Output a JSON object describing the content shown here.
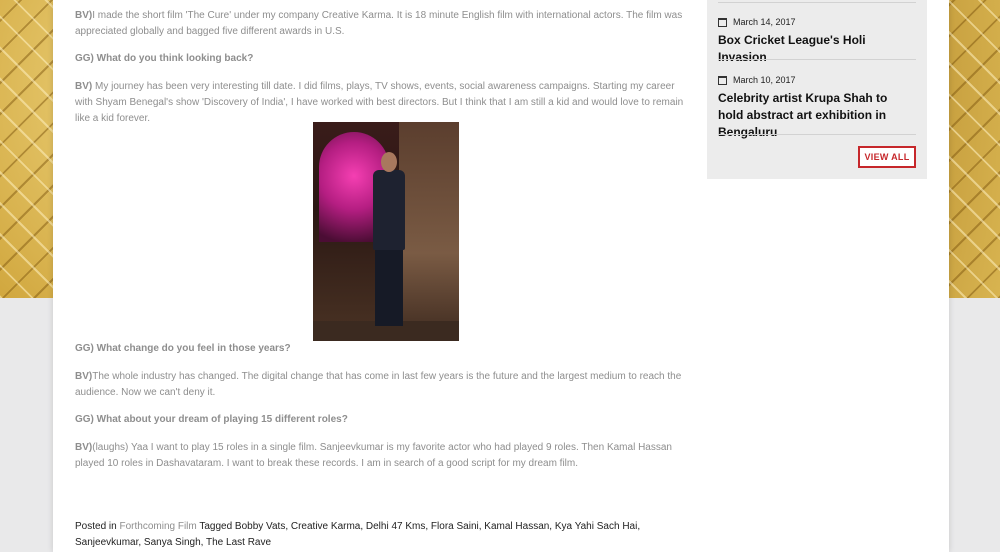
{
  "article": {
    "p1_speaker": "BV)",
    "p1_text": "I made the short film 'The Cure' under my company Creative Karma. It is 18 minute English film with international actors. The film was appreciated globally and bagged five different awards in U.S.",
    "q1": "GG) What do you think looking back?",
    "p2_speaker": "BV)",
    "p2_text": " My journey has been very interesting till date. I did films, plays, TV shows, events, social awareness campaigns. Starting my career with Shyam Benegal's show 'Discovery of India', I have worked with best directors. But I think that I am still a kid and would love to remain like a kid forever.",
    "q2": "GG) What change do you feel in those years?",
    "p3_speaker": "BV)",
    "p3_text": "The whole industry has changed. The digital change that has come in last few years is the future and the largest medium to reach the audience. Now we can't deny it.",
    "q3": "GG) What about your dream of playing 15 different roles?",
    "p4_speaker": "BV)",
    "p4_text": "(laughs) Yaa I want to play 15 roles in a single film. Sanjeevkumar is my favorite actor who had played 9 roles. Then Kamal Hassan played 10 roles in Dashavataram. I want to break these records. I am in search of a good script for my dream film."
  },
  "postmeta": {
    "posted_in_label": "Posted in ",
    "category": "Forthcoming Film",
    "tagged_label": " Tagged ",
    "tags": "Bobby Vats, Creative Karma, Delhi 47 Kms, Flora Saini, Kamal Hassan, Kya Yahi Sach Hai, Sanjeevkumar, Sanya Singh, The Last Rave"
  },
  "sidebar": {
    "items": [
      {
        "date": "March 14, 2017",
        "title": "Box Cricket League's Holi Invasion"
      },
      {
        "date": "March 10, 2017",
        "title": "Celebrity artist Krupa Shah to hold abstract art exhibition in Bengaluru"
      }
    ],
    "view_all_label": "VIEW ALL"
  },
  "icons": {
    "date": "calendar-icon"
  },
  "colors": {
    "accent": "#c6272b",
    "sidebar_bg": "#ececec",
    "body_text": "#8e8e8e"
  }
}
